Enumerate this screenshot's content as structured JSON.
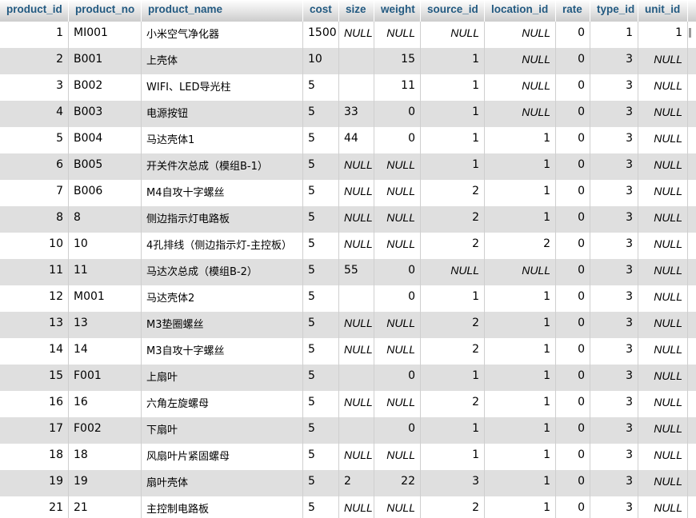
{
  "table": {
    "columns": [
      "product_id",
      "product_no",
      "product_name",
      "cost",
      "size",
      "weight",
      "source_id",
      "location_id",
      "rate",
      "type_id",
      "unit_id"
    ],
    "rows": [
      [
        "1",
        "MI001",
        "小米空气净化器",
        "1500",
        "NULL",
        "NULL",
        "NULL",
        "NULL",
        "0",
        "1",
        "1"
      ],
      [
        "2",
        "B001",
        "上壳体",
        "10",
        "",
        "15",
        "1",
        "NULL",
        "0",
        "3",
        "NULL"
      ],
      [
        "3",
        "B002",
        "WIFI、LED导光柱",
        "5",
        "",
        "11",
        "1",
        "NULL",
        "0",
        "3",
        "NULL"
      ],
      [
        "4",
        "B003",
        "电源按钮",
        "5",
        "33",
        "0",
        "1",
        "NULL",
        "0",
        "3",
        "NULL"
      ],
      [
        "5",
        "B004",
        "马达壳体1",
        "5",
        "44",
        "0",
        "1",
        "1",
        "0",
        "3",
        "NULL"
      ],
      [
        "6",
        "B005",
        "开关件次总成（模组B-1）",
        "5",
        "NULL",
        "NULL",
        "1",
        "1",
        "0",
        "3",
        "NULL"
      ],
      [
        "7",
        "B006",
        "M4自攻十字螺丝",
        "5",
        "NULL",
        "NULL",
        "2",
        "1",
        "0",
        "3",
        "NULL"
      ],
      [
        "8",
        "8",
        "侧边指示灯电路板",
        "5",
        "NULL",
        "NULL",
        "2",
        "1",
        "0",
        "3",
        "NULL"
      ],
      [
        "10",
        "10",
        "4孔排线（侧边指示灯-主控板）",
        "5",
        "NULL",
        "NULL",
        "2",
        "2",
        "0",
        "3",
        "NULL"
      ],
      [
        "11",
        "11",
        "马达次总成（模组B-2）",
        "5",
        "55",
        "0",
        "NULL",
        "NULL",
        "0",
        "3",
        "NULL"
      ],
      [
        "12",
        "M001",
        "马达壳体2",
        "5",
        "",
        "0",
        "1",
        "1",
        "0",
        "3",
        "NULL"
      ],
      [
        "13",
        "13",
        "M3垫圈螺丝",
        "5",
        "NULL",
        "NULL",
        "2",
        "1",
        "0",
        "3",
        "NULL"
      ],
      [
        "14",
        "14",
        "M3自攻十字螺丝",
        "5",
        "NULL",
        "NULL",
        "2",
        "1",
        "0",
        "3",
        "NULL"
      ],
      [
        "15",
        "F001",
        "上扇叶",
        "5",
        "",
        "0",
        "1",
        "1",
        "0",
        "3",
        "NULL"
      ],
      [
        "16",
        "16",
        "六角左旋螺母",
        "5",
        "NULL",
        "NULL",
        "2",
        "1",
        "0",
        "3",
        "NULL"
      ],
      [
        "17",
        "F002",
        "下扇叶",
        "5",
        "",
        "0",
        "1",
        "1",
        "0",
        "3",
        "NULL"
      ],
      [
        "18",
        "18",
        "风扇叶片紧固螺母",
        "5",
        "NULL",
        "NULL",
        "1",
        "1",
        "0",
        "3",
        "NULL"
      ],
      [
        "19",
        "19",
        "扇叶壳体",
        "5",
        "2",
        "22",
        "3",
        "1",
        "0",
        "3",
        "NULL"
      ],
      [
        "21",
        "21",
        "主控制电路板",
        "5",
        "NULL",
        "NULL",
        "2",
        "1",
        "0",
        "3",
        "NULL"
      ]
    ]
  }
}
